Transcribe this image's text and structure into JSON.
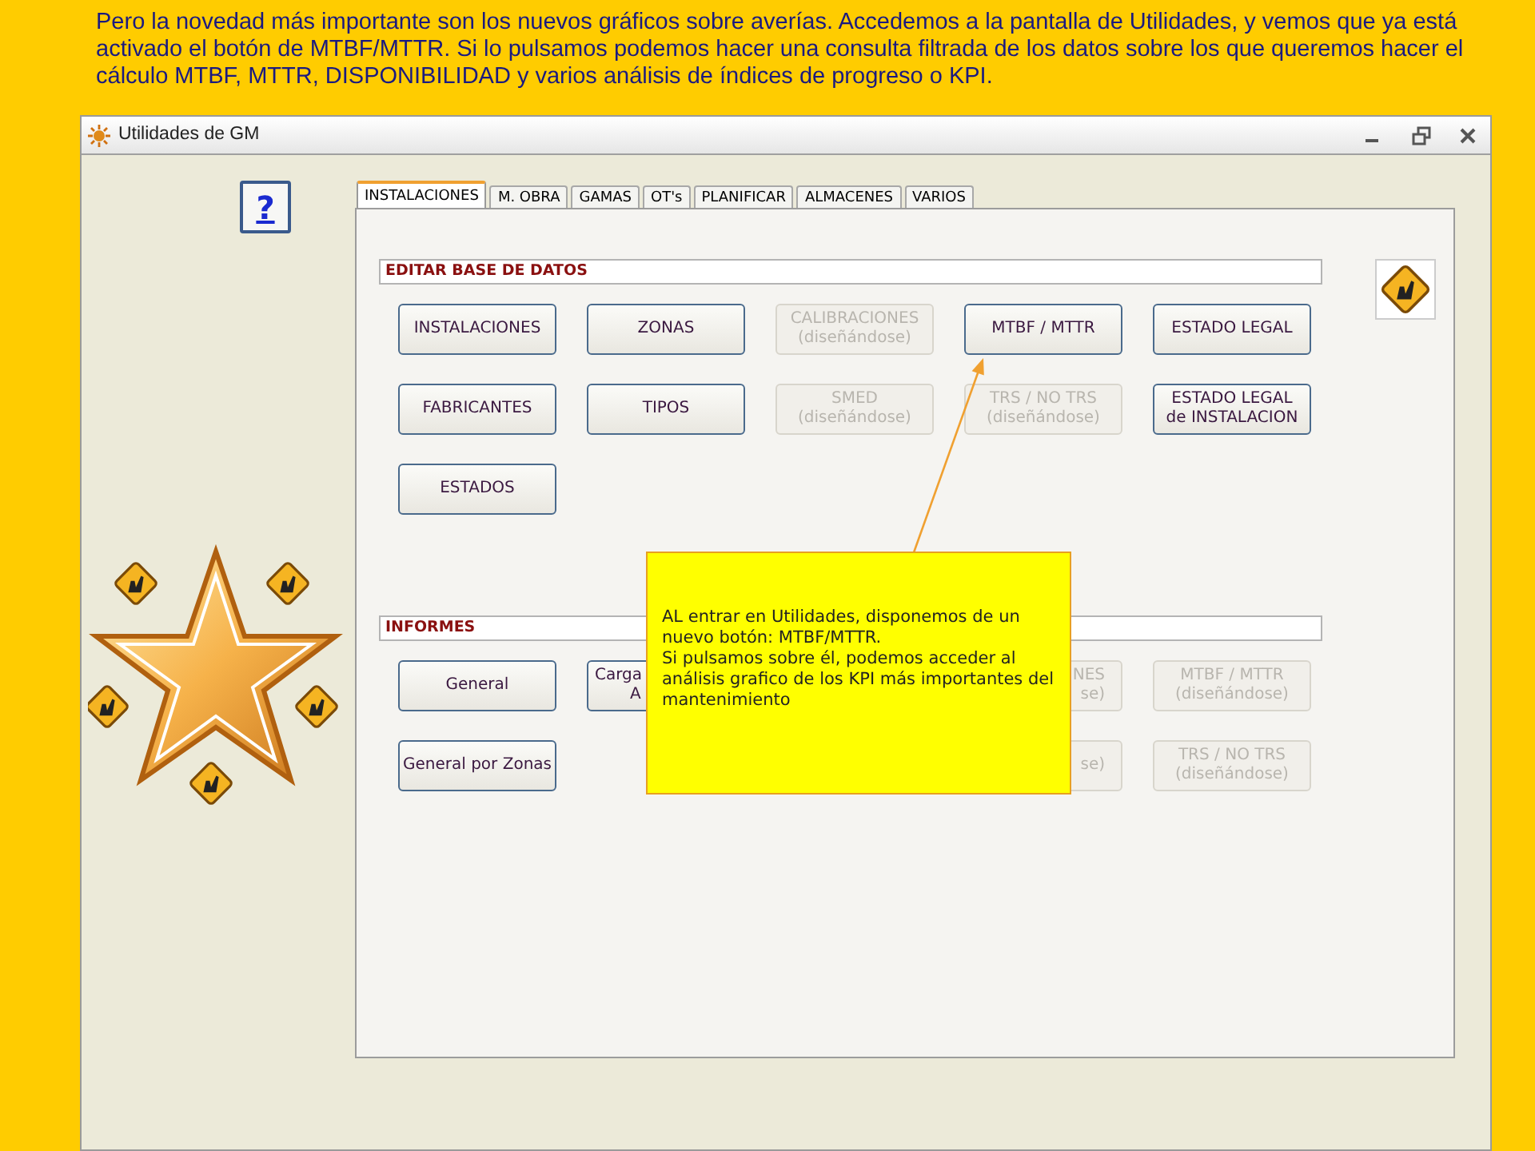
{
  "slide_text": "Pero la novedad más importante son  los nuevos gráficos sobre averías. Accedemos a la pantalla de Utilidades, y vemos que ya está activado el botón de MTBF/MTTR. Si lo pulsamos  podemos hacer una consulta filtrada de los datos sobre los que queremos hacer el cálculo MTBF, MTTR,  DISPONIBILIDAD y varios análisis de índices de progreso o KPI.",
  "window": {
    "title": "Utilidades de GM"
  },
  "help_button": {
    "label": "?"
  },
  "tabs": [
    {
      "label": "INSTALACIONES",
      "selected": true
    },
    {
      "label": "M. OBRA",
      "selected": false
    },
    {
      "label": "GAMAS",
      "selected": false
    },
    {
      "label": "OT's",
      "selected": false
    },
    {
      "label": "PLANIFICAR",
      "selected": false
    },
    {
      "label": "ALMACENES",
      "selected": false
    },
    {
      "label": "VARIOS",
      "selected": false
    }
  ],
  "sections": [
    {
      "title": "EDITAR BASE DE DATOS",
      "rows": [
        [
          {
            "kind": "normal",
            "lines": [
              "INSTALACIONES"
            ],
            "disabled": false
          },
          {
            "kind": "normal",
            "lines": [
              "ZONAS"
            ],
            "disabled": false
          },
          {
            "kind": "normal",
            "lines": [
              "CALIBRACIONES",
              "(diseñándose)"
            ],
            "disabled": true
          },
          {
            "kind": "normal",
            "lines": [
              "MTBF / MTTR"
            ],
            "disabled": false
          },
          {
            "kind": "normal",
            "lines": [
              "ESTADO LEGAL"
            ],
            "disabled": false
          }
        ],
        [
          {
            "kind": "normal",
            "lines": [
              "FABRICANTES"
            ],
            "disabled": false
          },
          {
            "kind": "normal",
            "lines": [
              "TIPOS"
            ],
            "disabled": false
          },
          {
            "kind": "normal",
            "lines": [
              "SMED",
              "(diseñándose)"
            ],
            "disabled": true
          },
          {
            "kind": "normal",
            "lines": [
              "TRS / NO TRS",
              "(diseñándose)"
            ],
            "disabled": true
          },
          {
            "kind": "normal",
            "lines": [
              "ESTADO LEGAL",
              "de INSTALACION"
            ],
            "disabled": false
          }
        ],
        [
          {
            "kind": "normal",
            "lines": [
              "ESTADOS"
            ],
            "disabled": false
          }
        ]
      ]
    },
    {
      "title": "INFORMES",
      "rows": [
        [
          {
            "kind": "normal",
            "lines": [
              "General"
            ],
            "disabled": false
          },
          {
            "kind": "covered_left",
            "lines": [
              "Carga",
              "A"
            ],
            "disabled": false
          },
          "",
          {
            "kind": "covered_right",
            "lines": [
              "NES",
              "se)"
            ],
            "disabled": true
          },
          {
            "kind": "normal",
            "lines": [
              "MTBF / MTTR",
              "(diseñándose)"
            ],
            "disabled": true
          }
        ],
        [
          {
            "kind": "normal",
            "lines": [
              "General por Zonas"
            ],
            "disabled": false
          },
          "",
          "",
          {
            "kind": "covered_right",
            "lines": [
              "se)"
            ],
            "disabled": true
          },
          {
            "kind": "normal",
            "lines": [
              "TRS / NO TRS",
              "(diseñándose)"
            ],
            "disabled": true
          }
        ]
      ]
    }
  ],
  "callout": {
    "paragraphs": [
      "AL entrar en Utilidades,  disponemos de un nuevo botón: MTBF/MTTR.",
      "Si pulsamos sobre él, podemos acceder al análisis grafico de los KPI más importantes del mantenimiento"
    ]
  }
}
